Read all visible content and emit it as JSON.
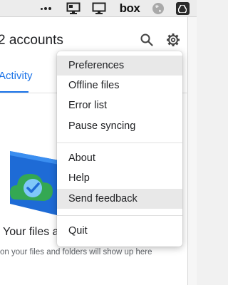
{
  "menubar": {
    "icons": [
      "more-dots-icon",
      "screen-mirror-icon",
      "display-icon",
      "box-icon",
      "globe-icon",
      "google-drive-icon"
    ],
    "box_label": "box"
  },
  "window": {
    "title": "2 accounts",
    "tab_label": "Activity",
    "empty_title": "Your files a",
    "empty_subtitle": "on your files and folders will show up here",
    "accent_color": "#1a73e8"
  },
  "menu": {
    "items": [
      {
        "label": "Preferences",
        "highlighted": true
      },
      {
        "label": "Offline files",
        "highlighted": false
      },
      {
        "label": "Error list",
        "highlighted": false
      },
      {
        "label": "Pause syncing",
        "highlighted": false
      },
      {
        "label": "About",
        "highlighted": false
      },
      {
        "label": "Help",
        "highlighted": false
      },
      {
        "label": "Send feedback",
        "highlighted": true
      },
      {
        "label": "Quit",
        "highlighted": false
      }
    ]
  }
}
